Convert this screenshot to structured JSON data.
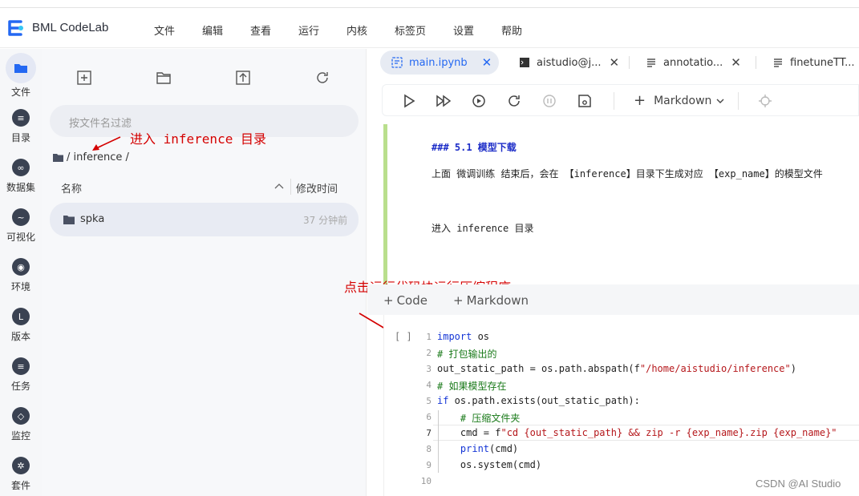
{
  "brand": {
    "name": "BML CodeLab"
  },
  "menu": [
    "文件",
    "编辑",
    "查看",
    "运行",
    "内核",
    "标签页",
    "设置",
    "帮助"
  ],
  "rail": [
    {
      "label": "文件",
      "icon": "folder-icon"
    },
    {
      "label": "目录",
      "icon": "list-icon"
    },
    {
      "label": "数据集",
      "icon": "dataset-icon"
    },
    {
      "label": "可视化",
      "icon": "chart-icon"
    },
    {
      "label": "环境",
      "icon": "environment-icon"
    },
    {
      "label": "版本",
      "icon": "version-icon"
    },
    {
      "label": "任务",
      "icon": "task-icon"
    },
    {
      "label": "监控",
      "icon": "monitor-icon"
    },
    {
      "label": "套件",
      "icon": "suite-icon"
    }
  ],
  "filepanel": {
    "filter_placeholder": "按文件名过滤",
    "breadcrumb": "/ inference /",
    "col_name": "名称",
    "col_modified": "修改时间",
    "rows": [
      {
        "name": "spka",
        "modified": "37 分钟前"
      }
    ]
  },
  "tabs": [
    {
      "label": "main.ipynb",
      "close": "✕"
    },
    {
      "label": "aistudio@j...",
      "close": "✕"
    },
    {
      "label": "annotatio...",
      "close": "✕"
    },
    {
      "label": "finetuneTT...",
      "close": ""
    }
  ],
  "toolbar": {
    "cell_type": "Markdown"
  },
  "markdown_cell": {
    "heading": "### 5.1 模型下载",
    "line1": "上面 微调训练 结束后，会在 【inference】目录下生成对应 【exp_name】的模型文件",
    "line2": "进入 inference 目录"
  },
  "add_bar": {
    "code": "Code",
    "markdown": "Markdown"
  },
  "code_cell": {
    "prompt": "[ ]",
    "line_numbers": [
      "1",
      "2",
      "3",
      "4",
      "5",
      "6",
      "7",
      "8",
      "9",
      "10"
    ]
  },
  "annotations": {
    "enter_dir": "进入 inference 目录",
    "click_run": "点击运行代码块运行压缩程序"
  },
  "watermark": "CSDN @AI Studio",
  "colors": {
    "accent": "#2468f2",
    "md_border": "#b9df8d",
    "annotation": "#d40000"
  }
}
